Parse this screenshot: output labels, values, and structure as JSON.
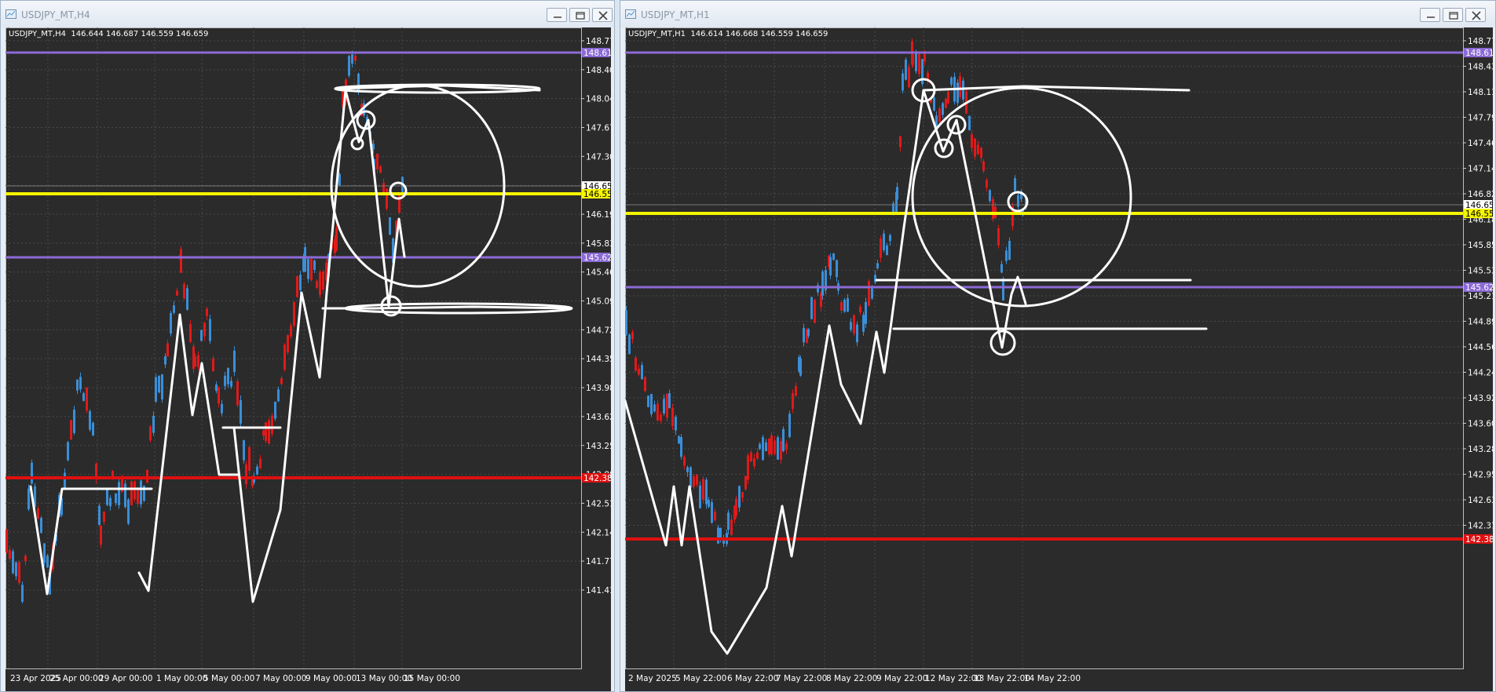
{
  "windows": [
    {
      "title": "USDJPY_MT,H4",
      "info": "USDJPY_MT,H4  146.644 146.687 146.559 146.659",
      "price_ticks": [
        "148.775",
        "148.405",
        "148.040",
        "147.670",
        "147.300",
        "146.935",
        "146.195",
        "145.830",
        "145.460",
        "145.090",
        "144.725",
        "144.355",
        "143.985",
        "143.620",
        "143.250",
        "142.880",
        "142.515",
        "142.145",
        "141.775",
        "141.410"
      ],
      "date_ticks": [
        "23 Apr 2025",
        "25 Apr 00:00",
        "29 Apr 00:00",
        "1 May 00:00",
        "5 May 00:00",
        "7 May 00:00",
        "9 May 00:00",
        "13 May 00:00",
        "15 May 00:00"
      ],
      "levels": [
        {
          "label": "148.611",
          "color": "#8c6ad6",
          "text_color": "#ffffff",
          "kind": "purple-upper"
        },
        {
          "label": "146.659",
          "color": "#ffffff",
          "text_color": "#000000",
          "kind": "current"
        },
        {
          "label": "146.552",
          "color": "#f5f500",
          "text_color": "#000000",
          "kind": "yellow"
        },
        {
          "label": "145.623",
          "color": "#8c6ad6",
          "text_color": "#ffffff",
          "kind": "purple-lower"
        },
        {
          "label": "142.380",
          "color": "#e01010",
          "text_color": "#ffffff",
          "kind": "red"
        }
      ]
    },
    {
      "title": "USDJPY_MT,H1",
      "info": "USDJPY_MT,H1  146.614 146.668 146.559 146.659",
      "price_ticks": [
        "148.775",
        "148.435",
        "148.110",
        "147.790",
        "147.465",
        "147.145",
        "146.820",
        "146.180",
        "145.855",
        "145.535",
        "145.210",
        "144.890",
        "144.565",
        "144.245",
        "143.920",
        "143.600",
        "143.280",
        "142.955",
        "142.635",
        "142.310"
      ],
      "date_ticks": [
        "2 May 2025",
        "5 May 22:00",
        "6 May 22:00",
        "7 May 22:00",
        "8 May 22:00",
        "9 May 22:00",
        "12 May 22:00",
        "13 May 22:00",
        "14 May 22:00"
      ],
      "levels": [
        {
          "label": "148.611",
          "color": "#8c6ad6",
          "text_color": "#ffffff",
          "kind": "purple-upper"
        },
        {
          "label": "146.659",
          "color": "#ffffff",
          "text_color": "#000000",
          "kind": "current"
        },
        {
          "label": "146.552",
          "color": "#f5f500",
          "text_color": "#000000",
          "kind": "yellow"
        },
        {
          "label": "145.623",
          "color": "#8c6ad6",
          "text_color": "#ffffff",
          "kind": "purple-lower"
        },
        {
          "label": "142.380",
          "color": "#e01010",
          "text_color": "#ffffff",
          "kind": "red"
        }
      ]
    }
  ],
  "colors": {
    "background": "#2b2b2b",
    "grid": "#4a4a4a",
    "bull": "#3a8fd8",
    "bear": "#e01a1a",
    "drawing": "#ffffff"
  },
  "icons": {
    "window": "chart-window-icon",
    "minimize": "minimize-icon",
    "restore": "restore-icon",
    "close": "close-icon"
  }
}
